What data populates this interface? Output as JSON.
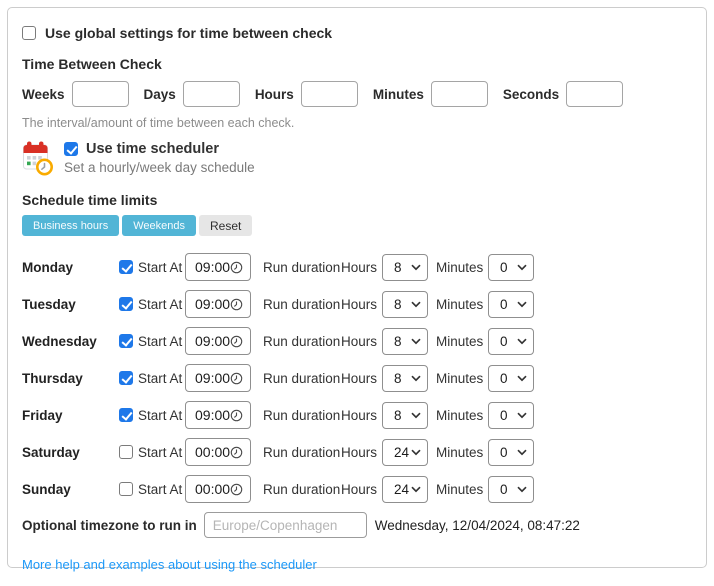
{
  "global": {
    "checkbox_label": "Use global settings for time between check",
    "checked": false
  },
  "time_between": {
    "heading": "Time Between Check",
    "fields": [
      {
        "label": "Weeks",
        "value": ""
      },
      {
        "label": "Days",
        "value": ""
      },
      {
        "label": "Hours",
        "value": ""
      },
      {
        "label": "Minutes",
        "value": ""
      },
      {
        "label": "Seconds",
        "value": ""
      }
    ],
    "help": "The interval/amount of time between each check."
  },
  "scheduler": {
    "icon": "calendar-clock-icon",
    "title": "Use time scheduler",
    "checked": true,
    "subtitle": "Set a hourly/week day schedule"
  },
  "schedule": {
    "heading": "Schedule time limits",
    "presets": [
      {
        "label": "Business hours"
      },
      {
        "label": "Weekends"
      },
      {
        "label": "Reset"
      }
    ],
    "labels": {
      "start_at": "Start At",
      "run_duration": "Run duration",
      "hours": "Hours",
      "minutes": "Minutes"
    },
    "days": [
      {
        "name": "Monday",
        "checked": true,
        "start": "09:00",
        "hours": "8",
        "minutes": "0"
      },
      {
        "name": "Tuesday",
        "checked": true,
        "start": "09:00",
        "hours": "8",
        "minutes": "0"
      },
      {
        "name": "Wednesday",
        "checked": true,
        "start": "09:00",
        "hours": "8",
        "minutes": "0"
      },
      {
        "name": "Thursday",
        "checked": true,
        "start": "09:00",
        "hours": "8",
        "minutes": "0"
      },
      {
        "name": "Friday",
        "checked": true,
        "start": "09:00",
        "hours": "8",
        "minutes": "0"
      },
      {
        "name": "Saturday",
        "checked": false,
        "start": "00:00",
        "hours": "24",
        "minutes": "0"
      },
      {
        "name": "Sunday",
        "checked": false,
        "start": "00:00",
        "hours": "24",
        "minutes": "0"
      }
    ]
  },
  "timezone": {
    "label": "Optional timezone to run in",
    "placeholder": "Europe/Copenhagen",
    "value": "",
    "current_datetime": "Wednesday, 12/04/2024, 08:47:22"
  },
  "help_link": "More help and examples about using the scheduler",
  "colors": {
    "preset_button": "#52b5d6",
    "reset_button": "#e6e6e6",
    "checkbox_accent": "#1e78e9",
    "link": "#1b98f8",
    "calendar_red": "#d93025",
    "calendar_green": "#34a853",
    "clock_orange": "#f9ab00"
  },
  "icons": [
    "calendar-clock-icon",
    "clock-icon",
    "chevron-down-icon",
    "checkbox-check-icon"
  ]
}
